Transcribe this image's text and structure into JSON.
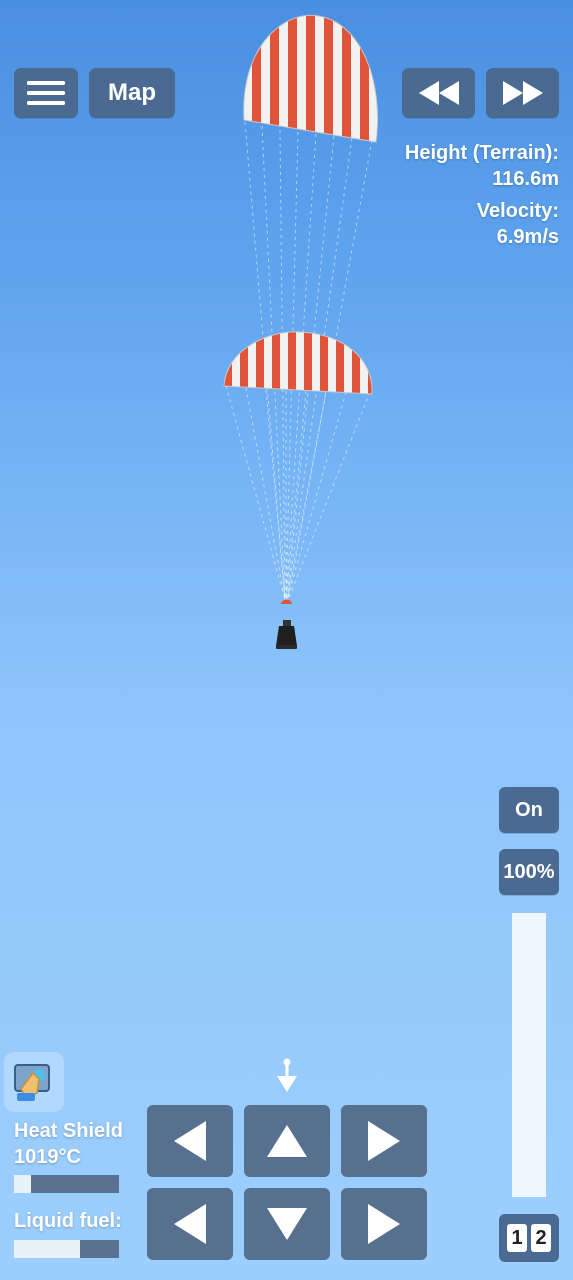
{
  "toolbar": {
    "menu_icon": "hamburger-menu-icon",
    "map_label": "Map",
    "rewind_icon": "rewind-icon",
    "fast_forward_icon": "fast-forward-icon"
  },
  "telemetry": {
    "height_label": "Height (Terrain):",
    "height_value": "116.6m",
    "velocity_label": "Velocity:",
    "velocity_value": "6.9m/s"
  },
  "throttle": {
    "toggle_label": "On",
    "percent_label": "100%",
    "level": 1.0
  },
  "stage_switch": {
    "left": "1",
    "right": "2"
  },
  "parts": {
    "heat_shield_label": "Heat Shield",
    "heat_shield_temp": "1019°C",
    "heat_shield_fill": 0.16,
    "liquid_fuel_label": "Liquid fuel:",
    "liquid_fuel_fill": 0.63
  },
  "controls": {
    "rotate_left_icon": "arrow-left-icon",
    "up_icon": "arrow-up-icon",
    "rotate_right_icon": "arrow-right-icon",
    "left_icon": "arrow-left-icon",
    "down_icon": "arrow-down-icon",
    "right_icon": "arrow-right-icon"
  },
  "colors": {
    "sky_top": "#4a8fe0",
    "sky_bottom": "#9dcffd",
    "button": "#4a6a91",
    "parachute_red": "#e0553a",
    "parachute_white": "#f2f2f2"
  }
}
